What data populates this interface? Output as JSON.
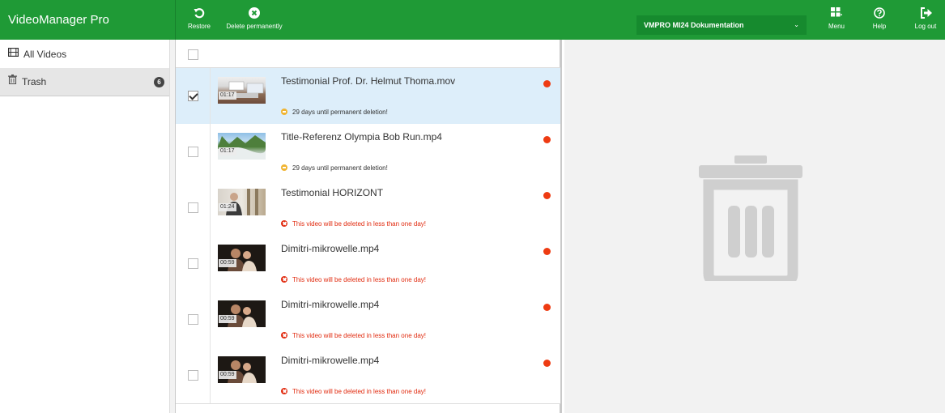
{
  "app": {
    "title": "VideoManager Pro"
  },
  "toolbar": {
    "restore_label": "Restore",
    "delete_label": "Delete permanently",
    "channel": "VMPRO MI24 Dokumentation",
    "menu_label": "Menu",
    "help_label": "Help",
    "logout_label": "Log out"
  },
  "sidebar": {
    "items": [
      {
        "label": "All Videos",
        "icon": "film-icon"
      },
      {
        "label": "Trash",
        "icon": "trash-icon",
        "badge": "6"
      }
    ]
  },
  "videos": [
    {
      "title": "Testimonial Prof. Dr. Helmut Thoma.mov",
      "duration": "01:17",
      "message": "29 days until permanent deletion!",
      "severity": "warning",
      "checked": true
    },
    {
      "title": "Title-Referenz Olympia Bob Run.mp4",
      "duration": "01:17",
      "message": "29 days until permanent deletion!",
      "severity": "warning",
      "checked": false
    },
    {
      "title": "Testimonial HORIZONT",
      "duration": "01:24",
      "message": "This video will be deleted in less than one day!",
      "severity": "error",
      "checked": false
    },
    {
      "title": "Dimitri-mikrowelle.mp4",
      "duration": "00:59",
      "message": "This video will be deleted in less than one day!",
      "severity": "error",
      "checked": false
    },
    {
      "title": "Dimitri-mikrowelle.mp4",
      "duration": "00:59",
      "message": "This video will be deleted in less than one day!",
      "severity": "error",
      "checked": false
    },
    {
      "title": "Dimitri-mikrowelle.mp4",
      "duration": "00:59",
      "message": "This video will be deleted in less than one day!",
      "severity": "error",
      "checked": false
    }
  ],
  "colors": {
    "brand": "#1f9a36",
    "selected_row": "#ddeefa",
    "status_dot": "#ee3b12",
    "warning": "#f0b431",
    "error": "#e12a0e"
  }
}
